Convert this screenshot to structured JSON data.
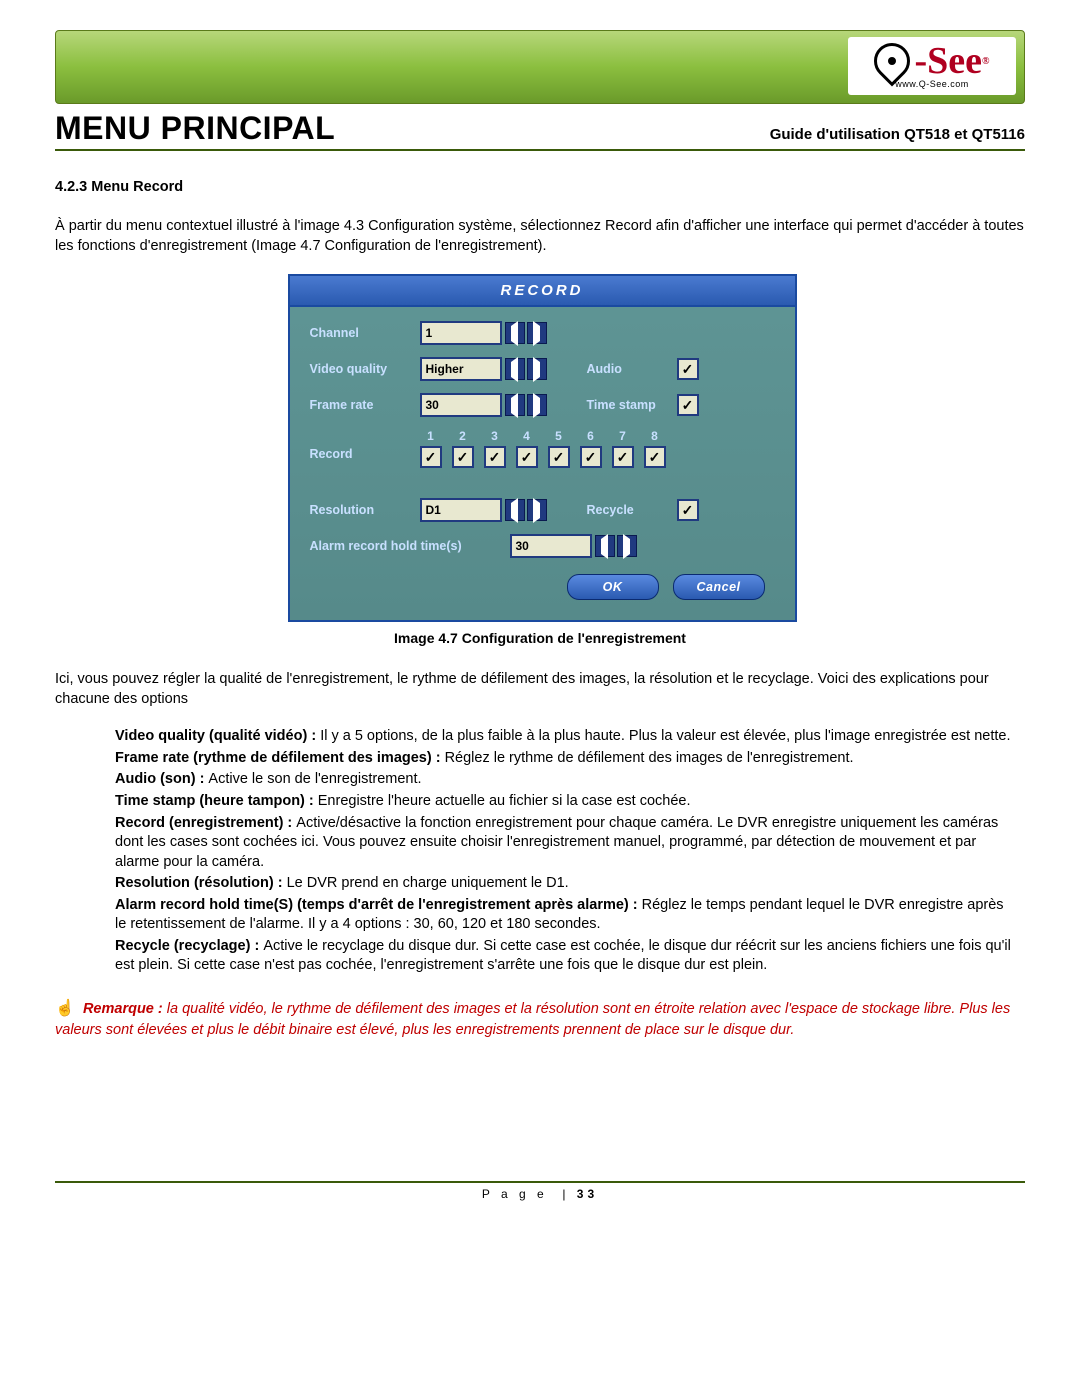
{
  "logo": {
    "brand": "-See",
    "url": "www.Q-See.com"
  },
  "header": {
    "title": "MENU PRINCIPAL",
    "subtitle": "Guide d'utilisation QT518 et QT5116"
  },
  "section": {
    "heading": "4.2.3 Menu Record",
    "intro": "À partir du menu contextuel illustré à l'image 4.3 Configuration système, sélectionnez Record afin d'afficher une interface qui permet d'accéder à toutes les fonctions d'enregistrement (Image 4.7 Configuration de l'enregistrement)."
  },
  "dvr": {
    "title": "RECORD",
    "labels": {
      "channel": "Channel",
      "video_quality": "Video quality",
      "frame_rate": "Frame rate",
      "audio": "Audio",
      "time_stamp": "Time stamp",
      "record": "Record",
      "resolution": "Resolution",
      "recycle": "Recycle",
      "alarm_hold": "Alarm record hold time(s)"
    },
    "values": {
      "channel": "1",
      "video_quality": "Higher",
      "frame_rate": "30",
      "resolution": "D1",
      "alarm_hold": "30"
    },
    "checks": {
      "audio": true,
      "time_stamp": true,
      "recycle": true,
      "record_channels": [
        {
          "n": "1",
          "on": true
        },
        {
          "n": "2",
          "on": true
        },
        {
          "n": "3",
          "on": true
        },
        {
          "n": "4",
          "on": true
        },
        {
          "n": "5",
          "on": true
        },
        {
          "n": "6",
          "on": true
        },
        {
          "n": "7",
          "on": true
        },
        {
          "n": "8",
          "on": true
        }
      ]
    },
    "buttons": {
      "ok": "OK",
      "cancel": "Cancel"
    }
  },
  "caption": "Image 4.7 Configuration de l'enregistrement",
  "post_caption": "Ici, vous pouvez régler la qualité de l'enregistrement, le rythme de défilement des images, la résolution et le recyclage. Voici des explications pour chacune des options",
  "defs": {
    "vq_b": "Video quality (qualité vidéo) : ",
    "vq_t": "Il y a 5 options, de la plus faible à la plus haute. Plus la valeur est élevée, plus l'image enregistrée est nette.",
    "fr_b": "Frame rate (rythme de défilement des images) : ",
    "fr_t": "Réglez le rythme de défilement des images de l'enregistrement.",
    "au_b": "Audio (son) : ",
    "au_t": "Active le son de l'enregistrement.",
    "ts_b": "Time stamp (heure tampon) : ",
    "ts_t": "Enregistre l'heure actuelle au fichier si la case est cochée.",
    "rec_b": "Record (enregistrement) : ",
    "rec_t": "Active/désactive la fonction enregistrement pour chaque caméra. Le DVR enregistre uniquement les caméras dont les cases sont cochées ici. Vous pouvez ensuite choisir l'enregistrement manuel, programmé, par détection de mouvement et par alarme pour la caméra.",
    "res_b": "Resolution (résolution) : ",
    "res_t": "Le DVR prend en charge uniquement le D1.",
    "al_b": "Alarm record hold time(S) (temps d'arrêt de l'enregistrement après alarme) : ",
    "al_t": "Réglez le temps pendant lequel le DVR enregistre après le retentissement de l'alarme. Il y a 4 options : 30, 60, 120 et 180 secondes.",
    "rc_b": "Recycle (recyclage) : ",
    "rc_t": "Active le recyclage du disque dur. Si cette case est cochée, le disque dur réécrit sur les anciens fichiers une fois qu'il est plein. Si cette case n'est pas cochée, l'enregistrement s'arrête une fois que le disque dur est plein."
  },
  "note": {
    "label": "Remarque :",
    "text": " la qualité vidéo, le rythme de défilement des images et la résolution sont en étroite relation avec l'espace de stockage libre. Plus les valeurs sont élevées et plus le débit binaire est élevé, plus les enregistrements prennent de place sur le disque dur."
  },
  "footer": {
    "page_label": "P a g e",
    "page_num": "33"
  }
}
